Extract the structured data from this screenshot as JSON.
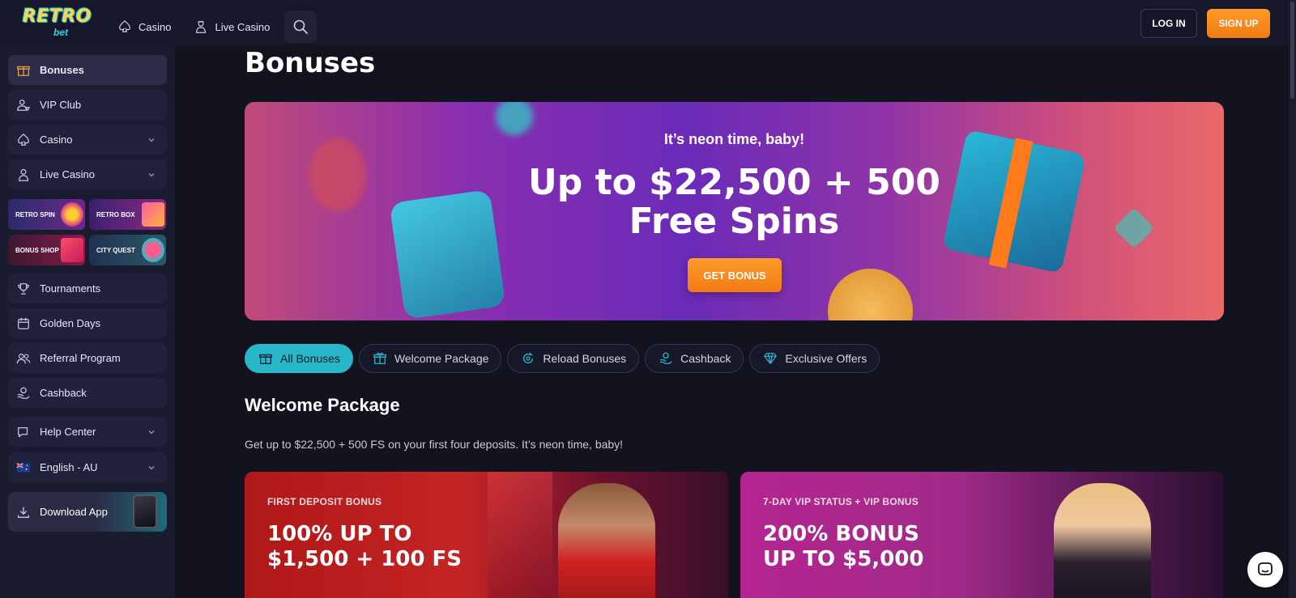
{
  "header": {
    "logo": {
      "top": "RETRO",
      "bottom": "bet"
    },
    "nav": [
      {
        "label": "Casino",
        "icon": "spade-icon"
      },
      {
        "label": "Live Casino",
        "icon": "dealer-icon"
      }
    ],
    "login_label": "LOG IN",
    "signup_label": "SIGN UP"
  },
  "sidebar": {
    "items": [
      {
        "label": "Bonuses",
        "icon": "gift-icon",
        "active": true
      },
      {
        "label": "VIP Club",
        "icon": "vip-icon"
      },
      {
        "label": "Casino",
        "icon": "spade-icon",
        "expandable": true
      },
      {
        "label": "Live Casino",
        "icon": "dealer-icon",
        "expandable": true
      }
    ],
    "tiles": [
      {
        "label": "RETRO SPIN"
      },
      {
        "label": "RETRO BOX"
      },
      {
        "label": "BONUS SHOP"
      },
      {
        "label": "CITY QUEST"
      }
    ],
    "items2": [
      {
        "label": "Tournaments",
        "icon": "trophy-icon"
      },
      {
        "label": "Golden Days",
        "icon": "calendar-icon"
      },
      {
        "label": "Referral Program",
        "icon": "users-icon"
      },
      {
        "label": "Cashback",
        "icon": "cashback-icon"
      }
    ],
    "help": {
      "label": "Help Center",
      "icon": "help-icon"
    },
    "language": {
      "label": "English - AU",
      "icon": "australia-flag-icon"
    },
    "download": {
      "label": "Download App",
      "icon": "download-icon"
    }
  },
  "main": {
    "title": "Bonuses",
    "hero": {
      "subtitle": "It’s neon time, baby!",
      "title_line1": "Up to $22,500 + 500",
      "title_line2": "Free Spins",
      "button": "GET BONUS"
    },
    "filters": [
      {
        "label": "All Bonuses",
        "icon": "gift-icon",
        "active": true
      },
      {
        "label": "Welcome Package",
        "icon": "gift-box-icon"
      },
      {
        "label": "Reload Bonuses",
        "icon": "reload-icon"
      },
      {
        "label": "Cashback",
        "icon": "cashback-icon"
      },
      {
        "label": "Exclusive Offers",
        "icon": "diamond-icon"
      }
    ],
    "section_title": "Welcome Package",
    "section_desc": "Get up to $22,500 + 500 FS on your first four deposits. It’s neon time, baby!",
    "cards": [
      {
        "kicker": "FIRST DEPOSIT BONUS",
        "line1": "100% UP TO",
        "line2": "$1,500 + 100 FS"
      },
      {
        "kicker": "7-DAY VIP STATUS + VIP BONUS",
        "line1": "200% BONUS",
        "line2": "UP TO $5,000"
      }
    ]
  },
  "colors": {
    "accent": "#28b6c9",
    "cta": "#f58a1f",
    "background": "#13131f"
  }
}
